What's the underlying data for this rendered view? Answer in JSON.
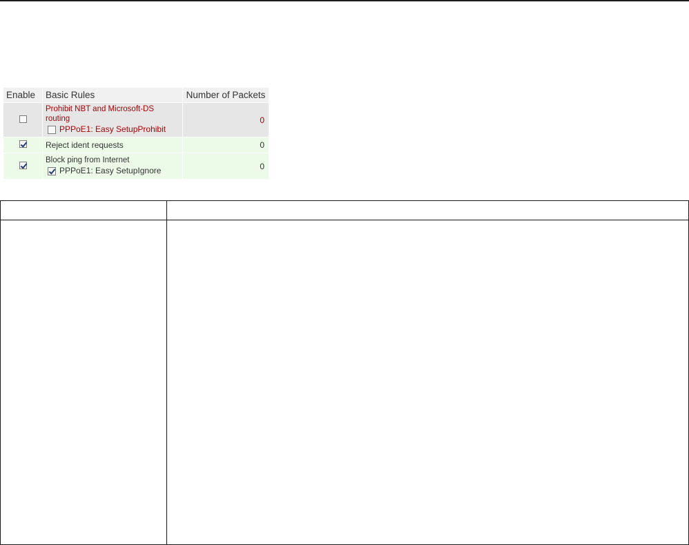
{
  "table": {
    "headers": {
      "enable": "Enable",
      "rules": "Basic Rules",
      "packets": "Number of Packets"
    },
    "rows": [
      {
        "rule": "Prohibit NBT and Microsoft-DS routing",
        "sub": "PPPoE1: Easy SetupProhibit",
        "packets": "0",
        "enabled": false,
        "sub_checked": false
      },
      {
        "rule": "Reject ident requests",
        "packets": "0",
        "enabled": true
      },
      {
        "rule": "Block ping from Internet",
        "sub": "PPPoE1: Easy SetupIgnore",
        "packets": "0",
        "enabled": true,
        "sub_checked": true
      }
    ]
  },
  "colors": {
    "prohibit_text": "#b00000",
    "prohibit_bg": "#e6e6e6",
    "row_green_bg": "#ecfbe8",
    "header_bg": "#f0f0f0"
  }
}
